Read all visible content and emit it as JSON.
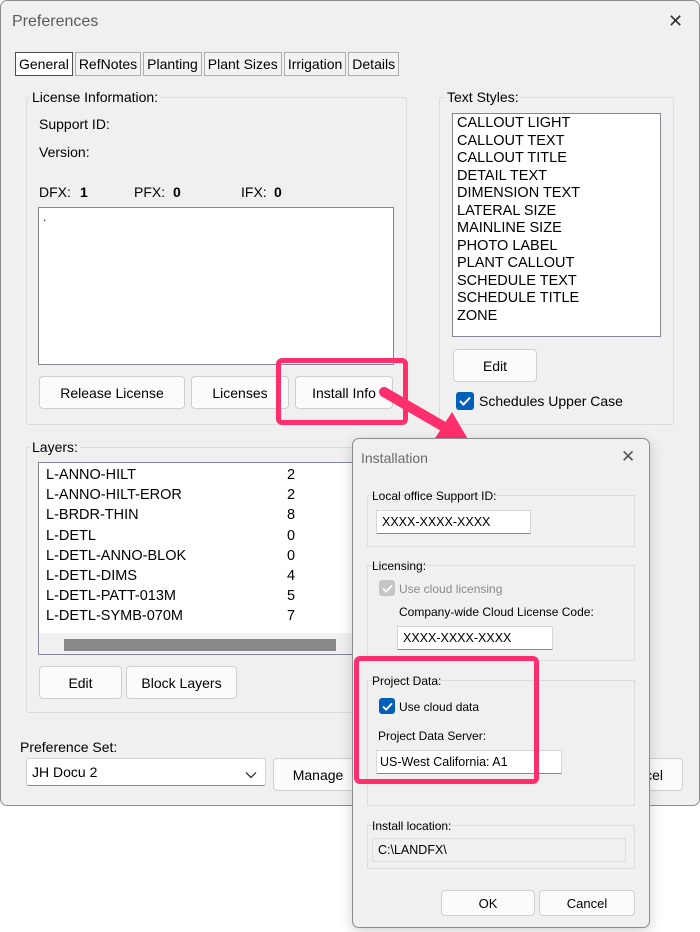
{
  "preferences": {
    "title": "Preferences",
    "tabs": [
      "General",
      "RefNotes",
      "Planting",
      "Plant Sizes",
      "Irrigation",
      "Details"
    ],
    "license": {
      "group_label": "License Information:",
      "support_id_label": "Support ID:",
      "version_label": "Version:",
      "dfx_label": "DFX:",
      "dfx_value": "1",
      "pfx_label": "PFX:",
      "pfx_value": "0",
      "ifx_label": "IFX:",
      "ifx_value": "0",
      "textarea_value": ".",
      "release_button": "Release License",
      "licenses_button": "Licenses",
      "install_info_button": "Install Info"
    },
    "text_styles": {
      "group_label": "Text Styles:",
      "items": [
        "CALLOUT LIGHT",
        "CALLOUT TEXT",
        "CALLOUT TITLE",
        "DETAIL TEXT",
        "DIMENSION TEXT",
        "LATERAL SIZE",
        "MAINLINE SIZE",
        "PHOTO LABEL",
        "PLANT CALLOUT",
        "SCHEDULE TEXT",
        "SCHEDULE TITLE",
        "ZONE"
      ],
      "edit_button": "Edit",
      "upper_case_label": "Schedules Upper Case",
      "upper_case_checked": true
    },
    "layers": {
      "group_label": "Layers:",
      "rows": [
        {
          "name": "L-ANNO-HILT",
          "value": "2"
        },
        {
          "name": "L-ANNO-HILT-EROR",
          "value": "2"
        },
        {
          "name": "L-BRDR-THIN",
          "value": "8"
        },
        {
          "name": "L-DETL",
          "value": "0"
        },
        {
          "name": "L-DETL-ANNO-BLOK",
          "value": "0"
        },
        {
          "name": "L-DETL-DIMS",
          "value": "4"
        },
        {
          "name": "L-DETL-PATT-013M",
          "value": "5"
        },
        {
          "name": "L-DETL-SYMB-070M",
          "value": "7"
        }
      ],
      "edit_button": "Edit",
      "block_layers_button": "Block Layers"
    },
    "preference_set": {
      "label": "Preference Set:",
      "selected": "JH Docu 2",
      "manage_button": "Manage",
      "cancel_button_partial": "cel"
    }
  },
  "installation": {
    "title": "Installation",
    "support_id_label": "Local office Support ID:",
    "support_id_value": "XXXX-XXXX-XXXX",
    "licensing_label": "Licensing:",
    "use_cloud_licensing_label": "Use cloud licensing",
    "use_cloud_licensing_checked": true,
    "cloud_code_label": "Company-wide Cloud License Code:",
    "cloud_code_value": "XXXX-XXXX-XXXX",
    "project_data_label": "Project Data:",
    "use_cloud_data_label": "Use cloud data",
    "use_cloud_data_checked": true,
    "server_label": "Project Data Server:",
    "server_value": "US-West California: A1",
    "install_location_label": "Install location:",
    "install_location_value": "C:\\LANDFX\\",
    "ok_button": "OK",
    "cancel_button": "Cancel"
  },
  "colors": {
    "highlight": "#ff2f6d",
    "accent_blue": "#005fb8"
  }
}
